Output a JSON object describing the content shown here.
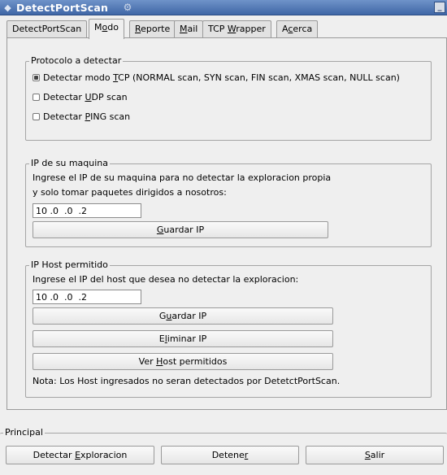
{
  "window": {
    "title": "DetectPortScan",
    "minimize_symbol": "_"
  },
  "icons": {
    "app": "app-icon",
    "title_deco": "tool-icon",
    "minimize": "minimize-icon"
  },
  "tabs": [
    {
      "pre": "DetectPortScan",
      "ul": "",
      "post": ""
    },
    {
      "pre": "M",
      "ul": "o",
      "post": "do"
    },
    {
      "pre": "",
      "ul": "R",
      "post": "eporte"
    },
    {
      "pre": "",
      "ul": "M",
      "post": "ail"
    },
    {
      "pre": "TCP ",
      "ul": "W",
      "post": "rapper"
    },
    {
      "pre": "A",
      "ul": "c",
      "post": "erca"
    }
  ],
  "active_tab": "Modo",
  "protocolo": {
    "legend": "Protocolo a detectar",
    "options": [
      {
        "pre": "Detectar modo ",
        "ul": "T",
        "post": "CP (NORMAL scan, SYN scan, FIN scan, XMAS scan, NULL scan)",
        "selected": true
      },
      {
        "pre": "Detectar ",
        "ul": "U",
        "post": "DP scan",
        "selected": false
      },
      {
        "pre": "Detectar ",
        "ul": "P",
        "post": "ING scan",
        "selected": false
      }
    ]
  },
  "ip_maquina": {
    "legend": "IP de su maquina",
    "desc_line1": "Ingrese el IP de su maquina para no detectar la exploracion propia",
    "desc_line2": "y solo tomar paquetes dirigidos a nosotros:",
    "value": "10 .0  .0  .2",
    "guardar": {
      "pre": "",
      "ul": "G",
      "post": "uardar IP"
    }
  },
  "ip_host": {
    "legend": "IP Host permitido",
    "desc": "Ingrese el IP del host que desea no detectar la exploracion:",
    "value": "10 .0  .0  .2",
    "guardar": {
      "pre": "G",
      "ul": "u",
      "post": "ardar IP"
    },
    "eliminar": {
      "pre": "E",
      "ul": "l",
      "post": "iminar IP"
    },
    "ver": {
      "pre": "Ver ",
      "ul": "H",
      "post": "ost permitidos"
    },
    "nota": "Nota: Los Host ingresados no seran detectados por DetetctPortScan."
  },
  "principal": {
    "legend": "Principal",
    "detectar": {
      "pre": "Detectar ",
      "ul": "E",
      "post": "xploracion"
    },
    "detener": {
      "pre": "Detene",
      "ul": "r",
      "post": ""
    },
    "salir": {
      "pre": "",
      "ul": "S",
      "post": "alir"
    }
  }
}
